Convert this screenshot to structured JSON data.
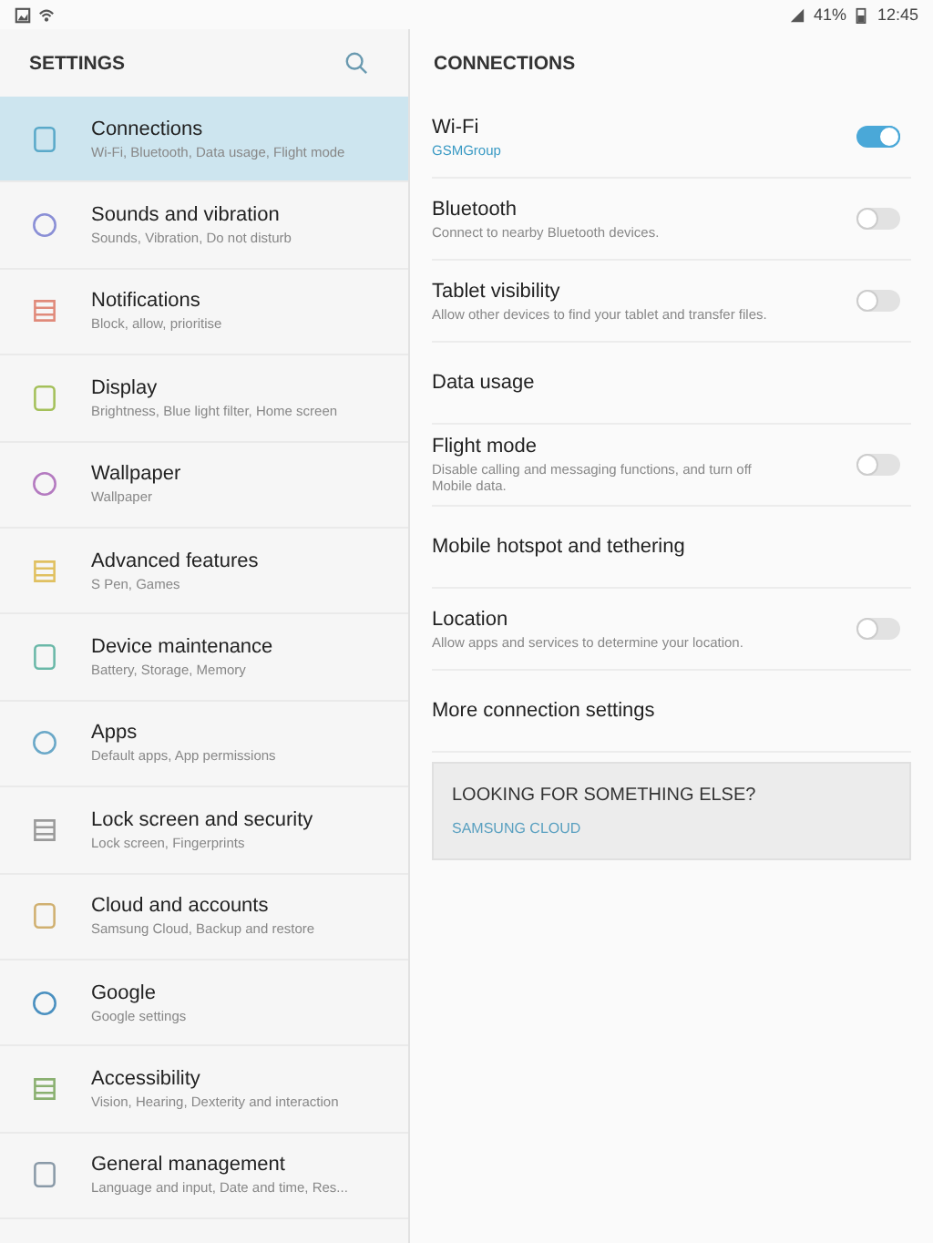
{
  "status_bar": {
    "battery": "41%",
    "time": "12:45"
  },
  "sidebar": {
    "title": "SETTINGS",
    "items": [
      {
        "label": "Connections",
        "detail": "Wi-Fi, Bluetooth, Data usage, Flight mode",
        "selected": true
      },
      {
        "label": "Sounds and vibration",
        "detail": "Sounds, Vibration, Do not disturb",
        "selected": false
      },
      {
        "label": "Notifications",
        "detail": "Block, allow, prioritise",
        "selected": false
      },
      {
        "label": "Display",
        "detail": "Brightness, Blue light filter, Home screen",
        "selected": false
      },
      {
        "label": "Wallpaper",
        "detail": "Wallpaper",
        "selected": false
      },
      {
        "label": "Advanced features",
        "detail": "S Pen, Games",
        "selected": false
      },
      {
        "label": "Device maintenance",
        "detail": "Battery, Storage, Memory",
        "selected": false
      },
      {
        "label": "Apps",
        "detail": "Default apps, App permissions",
        "selected": false
      },
      {
        "label": "Lock screen and security",
        "detail": "Lock screen, Fingerprints",
        "selected": false
      },
      {
        "label": "Cloud and accounts",
        "detail": "Samsung Cloud, Backup and restore",
        "selected": false
      },
      {
        "label": "Google",
        "detail": "Google settings",
        "selected": false
      },
      {
        "label": "Accessibility",
        "detail": "Vision, Hearing, Dexterity and interaction",
        "selected": false
      },
      {
        "label": "General management",
        "detail": "Language and input, Date and time, Res...",
        "selected": false
      }
    ]
  },
  "content": {
    "title": "CONNECTIONS",
    "rows": [
      {
        "kind": "toggle",
        "label": "Wi-Fi",
        "detail": "GSMGroup",
        "on": true
      },
      {
        "kind": "toggle",
        "label": "Bluetooth",
        "detail": "Connect to nearby Bluetooth devices.",
        "on": false
      },
      {
        "kind": "toggle",
        "label": "Tablet visibility",
        "detail": "Allow other devices to find your tablet and transfer files.",
        "on": false
      },
      {
        "kind": "link",
        "label": "Data usage"
      },
      {
        "kind": "toggle",
        "label": "Flight mode",
        "detail": "Disable calling and messaging functions, and turn off Mobile data.",
        "on": false
      },
      {
        "kind": "link",
        "label": "Mobile hotspot and tethering"
      },
      {
        "kind": "toggle",
        "label": "Location",
        "detail": "Allow apps and services to determine your location.",
        "on": false
      },
      {
        "kind": "link",
        "label": "More connection settings"
      }
    ],
    "suggestion": {
      "title": "LOOKING FOR SOMETHING ELSE?",
      "link": "SAMSUNG CLOUD"
    }
  }
}
